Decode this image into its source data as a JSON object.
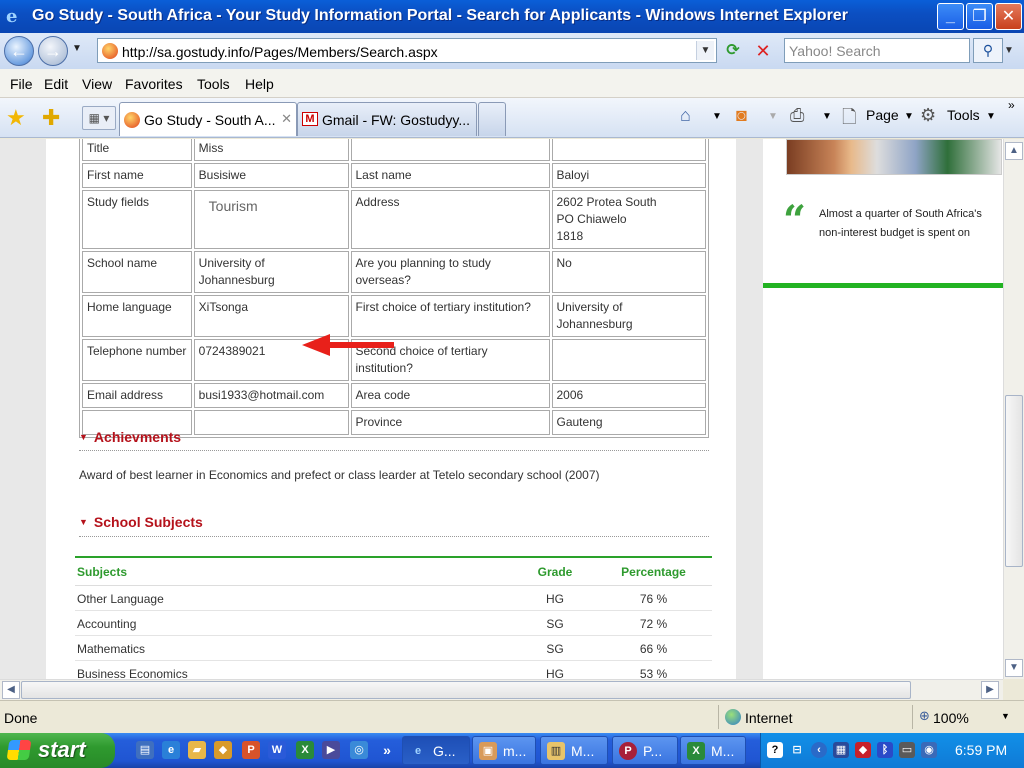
{
  "window": {
    "title": "Go Study - South Africa - Your Study Information Portal - Search for Applicants - Windows Internet Explorer",
    "minimize": "_",
    "maximize": "❐",
    "close": "✕"
  },
  "address": {
    "url": "http://sa.gostudy.info/Pages/Members/Search.aspx",
    "search_placeholder": "Yahoo! Search"
  },
  "menu": [
    "File",
    "Edit",
    "View",
    "Favorites",
    "Tools",
    "Help"
  ],
  "tabs": [
    {
      "label": "Go Study - South A...",
      "active": true
    },
    {
      "label": "Gmail - FW: Gostudyy...",
      "active": false
    }
  ],
  "commands": {
    "page": "Page",
    "tools": "Tools"
  },
  "profile": {
    "rows": [
      [
        "Title",
        "Miss",
        "",
        ""
      ],
      [
        "First name",
        "Busisiwe",
        "Last name",
        "Baloyi"
      ],
      [
        "Study fields",
        "Tourism",
        "Address",
        "2602 Protea South\nPO Chiawelo\n1818"
      ],
      [
        "School name",
        "University of Johannesburg",
        "Are you planning to study overseas?",
        "No"
      ],
      [
        "Home language",
        "XiTsonga",
        "First choice of tertiary institution?",
        "University of Johannesburg"
      ],
      [
        "Telephone number",
        "0724389021",
        "Second choice of tertiary institution?",
        ""
      ],
      [
        "Email address",
        "busi1933@hotmail.com",
        "Area code",
        "2006"
      ],
      [
        "",
        "",
        "Province",
        "Gauteng"
      ]
    ]
  },
  "achievements": {
    "heading": "Achievments",
    "text": "Award of best learner in Economics and prefect or class learder at Tetelo secondary school (2007)"
  },
  "subjects": {
    "heading": "School Subjects",
    "columns": [
      "Subjects",
      "Grade",
      "Percentage"
    ],
    "rows": [
      [
        "Other Language",
        "HG",
        "76 %"
      ],
      [
        "Accounting",
        "SG",
        "72 %"
      ],
      [
        "Mathematics",
        "SG",
        "66 %"
      ],
      [
        "Business Economics",
        "HG",
        "53 %"
      ]
    ]
  },
  "sidebar": {
    "quote": "Almost a quarter of South Africa's non-interest budget is spent on education."
  },
  "status": {
    "text": "Done",
    "zone": "Internet",
    "zoom": "100%"
  },
  "taskbar": {
    "start": "start",
    "items": [
      "G...",
      "m...",
      "M...",
      "P...",
      "M..."
    ],
    "clock": "6:59 PM"
  },
  "colors": {
    "accent_red": "#b5121b",
    "accent_green": "#2aa22a"
  }
}
